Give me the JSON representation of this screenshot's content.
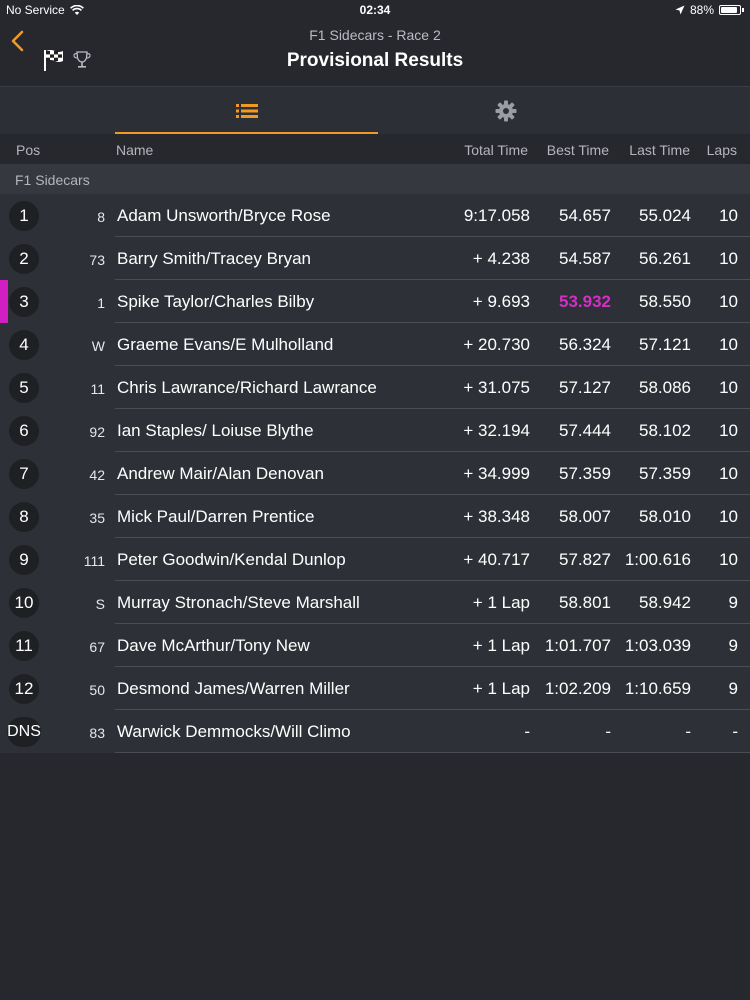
{
  "status_bar": {
    "carrier": "No Service",
    "time": "02:34",
    "battery": "88%",
    "battery_level": 0.88
  },
  "nav": {
    "subtitle": "F1 Sidecars - Race 2",
    "title": "Provisional Results"
  },
  "columns": {
    "pos": "Pos",
    "name": "Name",
    "total": "Total Time",
    "best": "Best Time",
    "last": "Last Time",
    "laps": "Laps"
  },
  "class_name": "F1 Sidecars",
  "colors": {
    "accent": "#f09a23",
    "fastest": "#d42ec6",
    "background": "#26282d"
  },
  "results": [
    {
      "pos": "1",
      "num": "8",
      "name": "Adam Unsworth/Bryce Rose",
      "total": "9:17.058",
      "best": "54.657",
      "last": "55.024",
      "laps": "10"
    },
    {
      "pos": "2",
      "num": "73",
      "name": "Barry Smith/Tracey Bryan",
      "total": "+ 4.238",
      "best": "54.587",
      "last": "56.261",
      "laps": "10"
    },
    {
      "pos": "3",
      "num": "1",
      "name": "Spike Taylor/Charles Bilby",
      "total": "+ 9.693",
      "best": "53.932",
      "last": "58.550",
      "laps": "10",
      "fastest": true
    },
    {
      "pos": "4",
      "num": "W",
      "name": "Graeme Evans/E Mulholland",
      "total": "+ 20.730",
      "best": "56.324",
      "last": "57.121",
      "laps": "10"
    },
    {
      "pos": "5",
      "num": "11",
      "name": "Chris Lawrance/Richard Lawrance",
      "total": "+ 31.075",
      "best": "57.127",
      "last": "58.086",
      "laps": "10"
    },
    {
      "pos": "6",
      "num": "92",
      "name": "Ian Staples/ Loiuse Blythe",
      "total": "+ 32.194",
      "best": "57.444",
      "last": "58.102",
      "laps": "10"
    },
    {
      "pos": "7",
      "num": "42",
      "name": "Andrew Mair/Alan Denovan",
      "total": "+ 34.999",
      "best": "57.359",
      "last": "57.359",
      "laps": "10"
    },
    {
      "pos": "8",
      "num": "35",
      "name": "Mick Paul/Darren Prentice",
      "total": "+ 38.348",
      "best": "58.007",
      "last": "58.010",
      "laps": "10"
    },
    {
      "pos": "9",
      "num": "111",
      "name": "Peter Goodwin/Kendal Dunlop",
      "total": "+ 40.717",
      "best": "57.827",
      "last": "1:00.616",
      "laps": "10"
    },
    {
      "pos": "10",
      "num": "S",
      "name": "Murray Stronach/Steve Marshall",
      "total": "+ 1 Lap",
      "best": "58.801",
      "last": "58.942",
      "laps": "9"
    },
    {
      "pos": "11",
      "num": "67",
      "name": "Dave McArthur/Tony New",
      "total": "+ 1 Lap",
      "best": "1:01.707",
      "last": "1:03.039",
      "laps": "9"
    },
    {
      "pos": "12",
      "num": "50",
      "name": "Desmond James/Warren Miller",
      "total": "+ 1 Lap",
      "best": "1:02.209",
      "last": "1:10.659",
      "laps": "9"
    },
    {
      "pos": "DNS",
      "num": "83",
      "name": "Warwick Demmocks/Will Climo",
      "total": "-",
      "best": "-",
      "last": "-",
      "laps": "-"
    }
  ]
}
